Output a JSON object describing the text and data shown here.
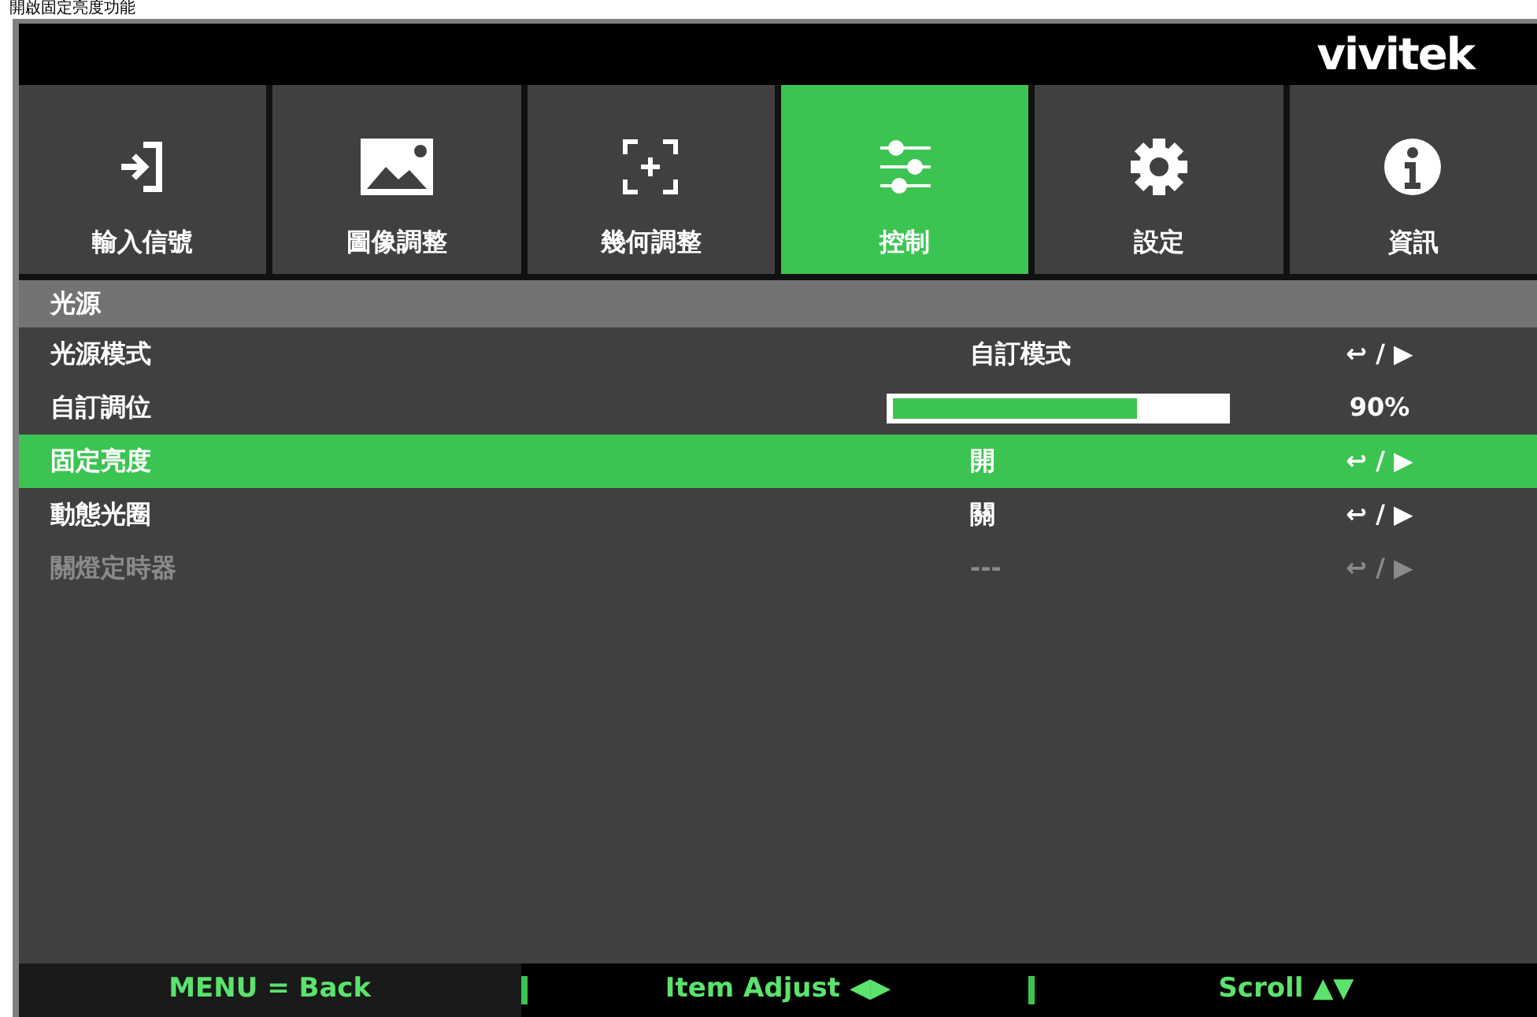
{
  "caption": "開啟固定亮度功能",
  "logo": "vivitek",
  "tabs": [
    {
      "label": "輸入信號",
      "selected": false
    },
    {
      "label": "圖像調整",
      "selected": false
    },
    {
      "label": "幾何調整",
      "selected": false
    },
    {
      "label": "控制",
      "selected": true
    },
    {
      "label": "設定",
      "selected": false
    },
    {
      "label": "資訊",
      "selected": false
    }
  ],
  "section": "光源",
  "rows": [
    {
      "kind": "option",
      "label": "光源模式",
      "value": "自訂模式",
      "action": "↩ / ▶",
      "selected": false,
      "disabled": false
    },
    {
      "kind": "slider",
      "label": "自訂調位",
      "level": 0.74,
      "value": "90%",
      "selected": false,
      "disabled": false
    },
    {
      "kind": "option",
      "label": "固定亮度",
      "value": "開",
      "action": "↩ / ▶",
      "selected": true,
      "disabled": false
    },
    {
      "kind": "option",
      "label": "動態光圈",
      "value": "關",
      "action": "↩ / ▶",
      "selected": false,
      "disabled": false
    },
    {
      "kind": "option",
      "label": "關燈定時器",
      "value": "---",
      "action": "↩ / ▶",
      "selected": false,
      "disabled": true
    }
  ],
  "footer": [
    "MENU = Back",
    "Item Adjust ◀▶",
    "Scroll ▲▼"
  ]
}
